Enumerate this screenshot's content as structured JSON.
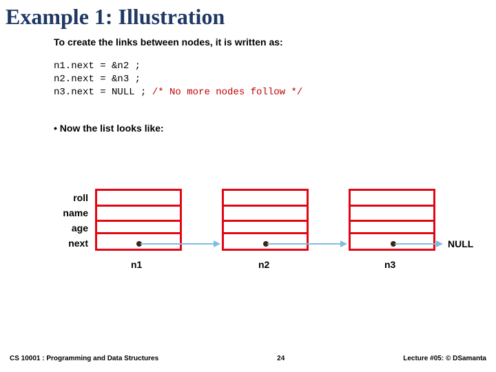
{
  "title": "Example 1: Illustration",
  "intro": "To create the links between nodes, it is written as:",
  "code": {
    "line1": "n1.next = &n2 ;",
    "line2": "n2.next = &n3 ;",
    "line3a": "n3.next = NULL ;  ",
    "line3b": "/* No more nodes follow */"
  },
  "bullet": "• Now the list looks like:",
  "fields": {
    "roll": "roll",
    "name": "name",
    "age": "age",
    "next": "next"
  },
  "nodes": {
    "n1": "n1",
    "n2": "n2",
    "n3": "n3"
  },
  "null_label": "NULL",
  "footer": {
    "left": "CS 10001 : Programming and Data Structures",
    "center": "24",
    "right": "Lecture #05: © DSamanta"
  }
}
